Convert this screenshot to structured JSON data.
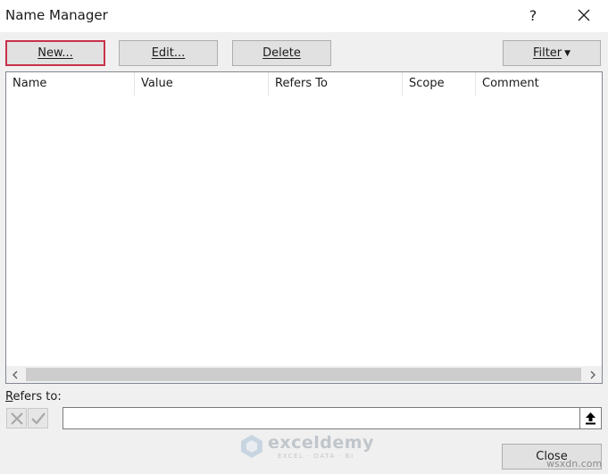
{
  "window": {
    "title": "Name Manager",
    "help_label": "?"
  },
  "toolbar": {
    "new_label": "New...",
    "edit_label": "Edit...",
    "delete_label": "Delete",
    "filter_label": "Filter",
    "filter_arrow": "▼"
  },
  "table": {
    "columns": [
      "Name",
      "Value",
      "Refers To",
      "Scope",
      "Comment"
    ],
    "rows": []
  },
  "scrollbar": {
    "left_arrow_icon": "chevron-left-icon",
    "right_arrow_icon": "chevron-right-icon"
  },
  "refers_to": {
    "label_first": "R",
    "label_rest": "efers to:",
    "value": ""
  },
  "footer": {
    "close_label": "Close"
  },
  "watermark": {
    "name": "exceldemy",
    "tagline": "EXCEL · DATA · BI",
    "credit": "wsxdn.com"
  },
  "colors": {
    "highlight_border": "#c8324b",
    "button_face": "#e1e1e1",
    "dialog_background": "#f0f0f0"
  }
}
